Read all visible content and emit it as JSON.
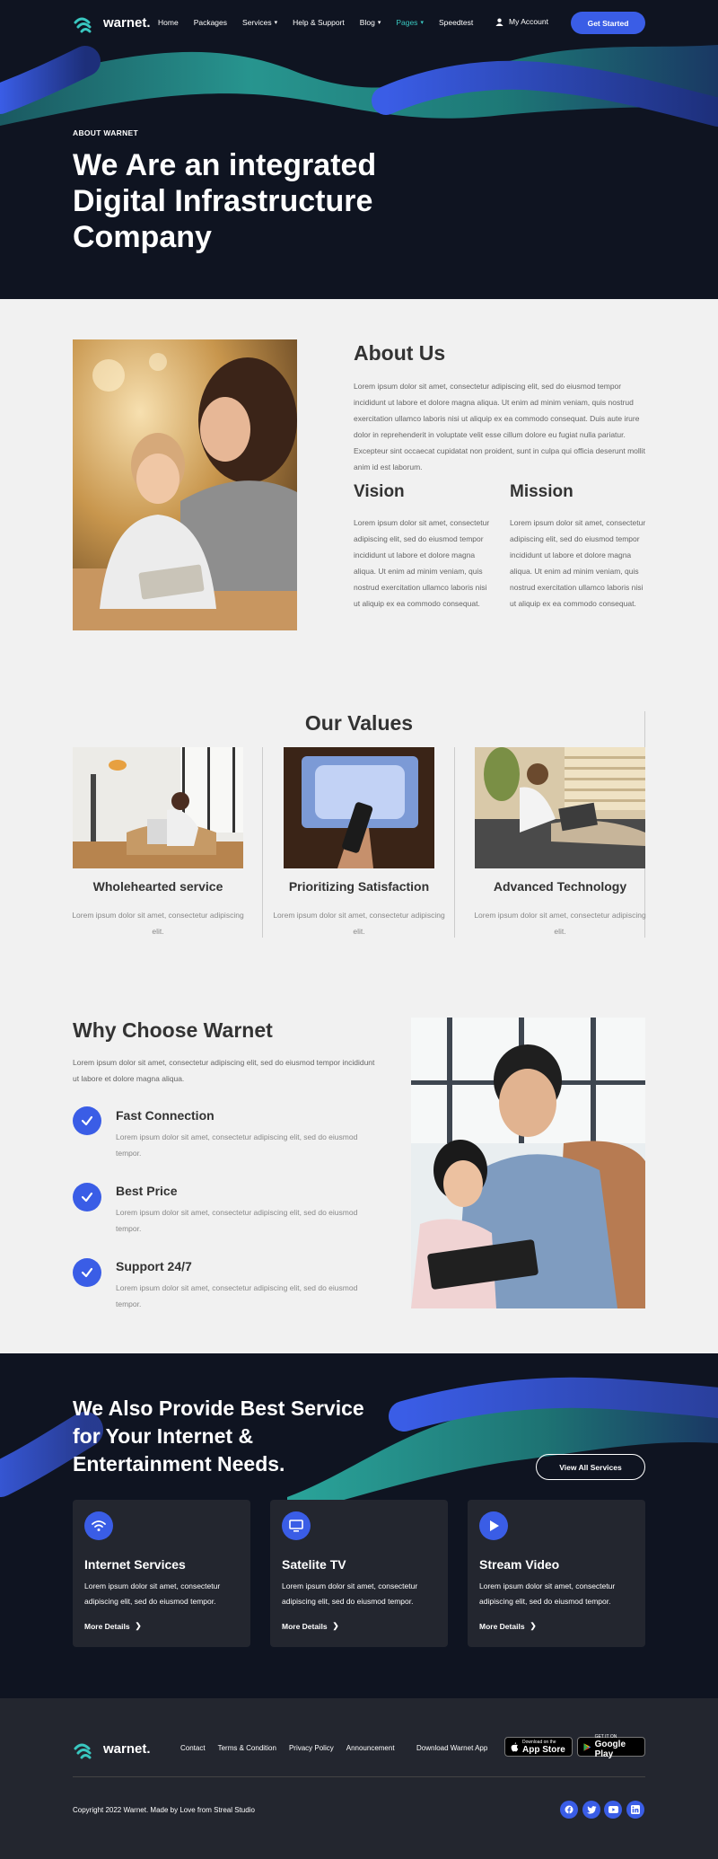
{
  "header": {
    "logo_text": "warnet.",
    "nav": [
      {
        "label": "Home",
        "dropdown": false,
        "active": false
      },
      {
        "label": "Packages",
        "dropdown": false,
        "active": false
      },
      {
        "label": "Services",
        "dropdown": true,
        "active": false
      },
      {
        "label": "Help & Support",
        "dropdown": false,
        "active": false
      },
      {
        "label": "Blog",
        "dropdown": true,
        "active": false
      },
      {
        "label": "Pages",
        "dropdown": true,
        "active": true
      },
      {
        "label": "Speedtest",
        "dropdown": false,
        "active": false
      }
    ],
    "account_label": "My Account",
    "cta_label": "Get Started"
  },
  "hero": {
    "eyebrow": "ABOUT WARNET",
    "title": "We Are an integrated Digital Infrastructure Company"
  },
  "about": {
    "title": "About Us",
    "text": "Lorem ipsum dolor sit amet, consectetur adipiscing elit, sed do eiusmod tempor incididunt ut labore et dolore magna aliqua. Ut enim ad minim veniam, quis nostrud exercitation ullamco laboris nisi ut aliquip ex ea commodo consequat. Duis aute irure dolor in reprehenderit in voluptate velit esse cillum dolore eu fugiat nulla pariatur. Excepteur sint occaecat cupidatat non proident, sunt in culpa qui officia deserunt mollit anim id est laborum.",
    "vision": {
      "title": "Vision",
      "text": "Lorem ipsum dolor sit amet, consectetur adipiscing elit, sed do eiusmod tempor incididunt ut labore et dolore magna aliqua. Ut enim ad minim veniam, quis nostrud exercitation ullamco laboris nisi ut aliquip ex ea commodo consequat."
    },
    "mission": {
      "title": "Mission",
      "text": "Lorem ipsum dolor sit amet, consectetur adipiscing elit, sed do eiusmod tempor incididunt ut labore et dolore magna aliqua. Ut enim ad minim veniam, quis nostrud exercitation ullamco laboris nisi ut aliquip ex ea commodo consequat."
    }
  },
  "values": {
    "title": "Our Values",
    "items": [
      {
        "title": "Wholehearted service",
        "text": "Lorem ipsum dolor sit amet, consectetur adipiscing elit."
      },
      {
        "title": "Prioritizing Satisfaction",
        "text": "Lorem ipsum dolor sit amet, consectetur adipiscing elit."
      },
      {
        "title": "Advanced Technology",
        "text": "Lorem ipsum dolor sit amet, consectetur adipiscing elit."
      }
    ]
  },
  "why": {
    "title": "Why Choose Warnet",
    "text": "Lorem ipsum dolor sit amet, consectetur adipiscing elit, sed do eiusmod tempor incididunt ut labore et dolore magna aliqua.",
    "features": [
      {
        "title": "Fast Connection",
        "text": "Lorem ipsum dolor sit amet, consectetur adipiscing elit, sed do eiusmod tempor."
      },
      {
        "title": "Best Price",
        "text": "Lorem ipsum dolor sit amet, consectetur adipiscing elit, sed do eiusmod tempor."
      },
      {
        "title": "Support 24/7",
        "text": "Lorem ipsum dolor sit amet, consectetur adipiscing elit, sed do eiusmod tempor."
      }
    ]
  },
  "services": {
    "title": "We Also Provide Best Service for Your Internet & Entertainment Needs.",
    "view_all_label": "View All Services",
    "cards": [
      {
        "icon": "wifi-icon",
        "title": "Internet Services",
        "text": "Lorem ipsum dolor sit amet, consectetur adipiscing elit, sed do eiusmod tempor.",
        "link": "More Details"
      },
      {
        "icon": "tv-icon",
        "title": "Satelite TV",
        "text": "Lorem ipsum dolor sit amet, consectetur adipiscing elit, sed do eiusmod tempor.",
        "link": "More Details"
      },
      {
        "icon": "play-icon",
        "title": "Stream Video",
        "text": "Lorem ipsum dolor sit amet, consectetur adipiscing elit, sed do eiusmod tempor.",
        "link": "More Details"
      }
    ]
  },
  "footer": {
    "logo_text": "warnet.",
    "links": [
      "Contact",
      "Terms & Condition",
      "Privacy Policy",
      "Announcement"
    ],
    "download_label": "Download Warnet App",
    "app_store": {
      "small": "Download on the",
      "large": "App Store"
    },
    "google_play": {
      "small": "GET IT ON",
      "large": "Google Play"
    },
    "copyright": "Copyright 2022 Warnet. Made by Love from Streal Studio",
    "socials": [
      "facebook-icon",
      "twitter-icon",
      "youtube-icon",
      "linkedin-icon"
    ]
  },
  "colors": {
    "primary": "#3a5de6",
    "teal": "#2db5a8",
    "dark_bg": "#0f1421",
    "card_bg": "#23262f",
    "light_bg": "#f1f1f1"
  }
}
